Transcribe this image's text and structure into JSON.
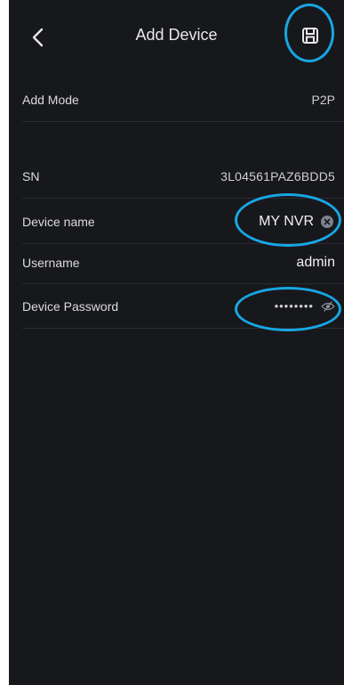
{
  "header": {
    "title": "Add Device"
  },
  "rows": {
    "add_mode": {
      "label": "Add Mode",
      "value": "P2P"
    },
    "sn": {
      "label": "SN",
      "value": "3L04561PAZ6BDD5"
    },
    "device_name": {
      "label": "Device name",
      "value": "MY NVR"
    },
    "username": {
      "label": "Username",
      "value": "admin"
    },
    "password": {
      "label": "Device Password",
      "value": "••••••••"
    }
  },
  "colors": {
    "background": "#17181c",
    "text": "#e8e8ea",
    "highlight": "#18a6e2"
  },
  "icons": {
    "back": "chevron-left-icon",
    "save": "save-icon",
    "clear": "clear-icon",
    "visibility": "eye-icon"
  }
}
